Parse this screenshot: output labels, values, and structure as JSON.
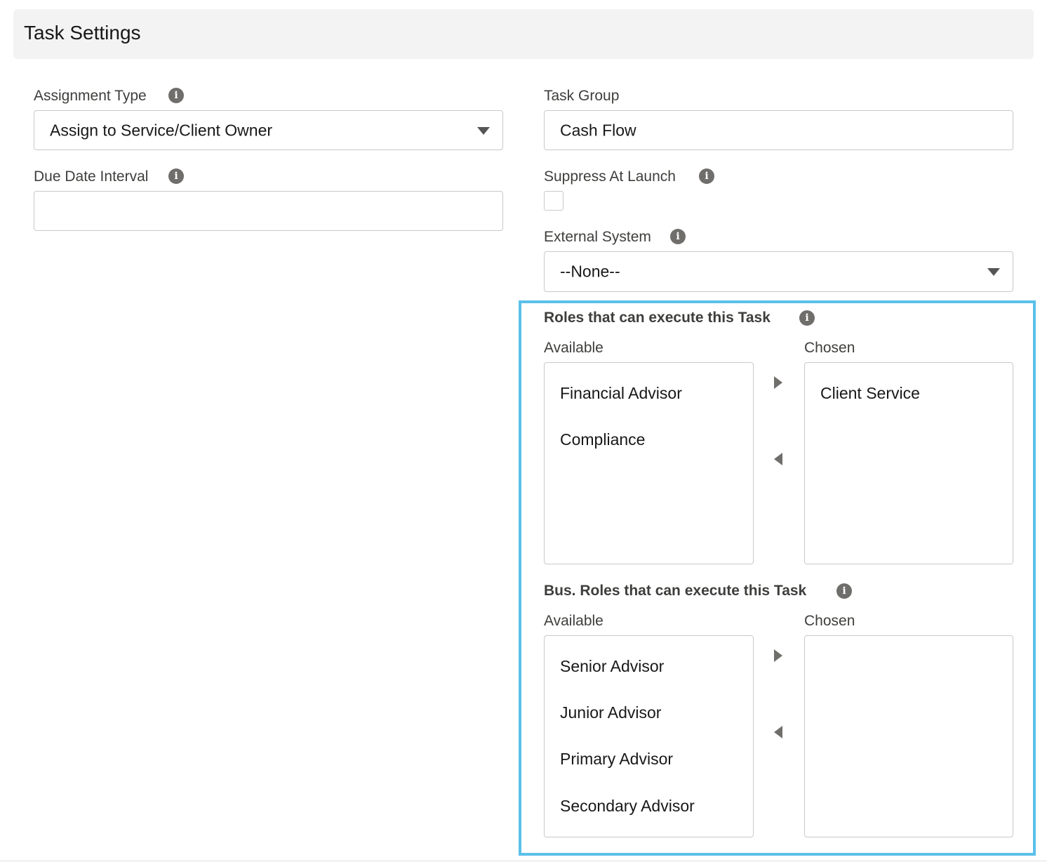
{
  "header": {
    "title": "Task Settings"
  },
  "assignment_type": {
    "label": "Assignment Type",
    "value": "Assign to Service/Client Owner"
  },
  "task_group": {
    "label": "Task Group",
    "value": "Cash Flow"
  },
  "due_date_interval": {
    "label": "Due Date Interval",
    "value": ""
  },
  "suppress_at_launch": {
    "label": "Suppress At Launch",
    "checked": false
  },
  "external_system": {
    "label": "External System",
    "value": "--None--"
  },
  "roles": {
    "title": "Roles that can execute this Task",
    "available_label": "Available",
    "chosen_label": "Chosen",
    "available": [
      "Financial Advisor",
      "Compliance"
    ],
    "chosen": [
      "Client Service"
    ]
  },
  "bus_roles": {
    "title": "Bus. Roles that can execute this Task",
    "available_label": "Available",
    "chosen_label": "Chosen",
    "available": [
      "Senior Advisor",
      "Junior Advisor",
      "Primary Advisor",
      "Secondary Advisor"
    ],
    "chosen": []
  },
  "icons": {
    "info": "i",
    "info_icon_name": "info-icon",
    "dropdown_icon_name": "chevron-down-icon",
    "move_right_icon_name": "arrow-right-icon",
    "move_left_icon_name": "arrow-left-icon"
  },
  "colors": {
    "highlight_border": "#5bc0ea",
    "header_background": "#f3f3f3",
    "icon_gray": "#706e6b"
  }
}
